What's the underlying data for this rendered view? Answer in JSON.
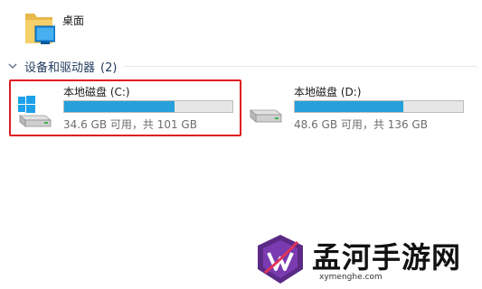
{
  "desktop_item": {
    "label": "桌面",
    "icon": "folder-desktop-icon"
  },
  "section": {
    "label": "设备和驱动器",
    "count": "(2)",
    "icon": "chevron-down-icon"
  },
  "drives": [
    {
      "name": "本地磁盘 (C:)",
      "size_text": "34.6 GB 可用，共 101 GB",
      "used_fraction": 0.657,
      "icon": "windows-drive-icon",
      "highlighted": true
    },
    {
      "name": "本地磁盘 (D:)",
      "size_text": "48.6 GB 可用，共 136 GB",
      "used_fraction": 0.643,
      "icon": "hard-drive-icon",
      "highlighted": false
    }
  ],
  "colors": {
    "bar_fill": "#26a0da",
    "highlight_border": "#e01c24",
    "section_text": "#1e395b"
  },
  "watermark": {
    "brand": "孟河手游网",
    "url": "xymenghe.com"
  }
}
